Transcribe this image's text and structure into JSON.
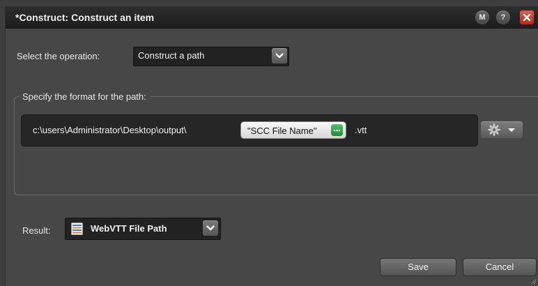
{
  "window": {
    "title": "*Construct: Construct an item",
    "buttons": {
      "m_label": "M",
      "help_label": "?"
    }
  },
  "operation": {
    "label": "Select the operation:",
    "value": "Construct a path"
  },
  "format": {
    "legend": "Specify the format for the path:",
    "path_prefix": "c:\\users\\Administrator\\Desktop\\output\\",
    "token_label": "\"SCC File Name\"",
    "path_suffix": ".vtt"
  },
  "result": {
    "label": "Result:",
    "value": "WebVTT File Path"
  },
  "actions": {
    "save_label": "Save",
    "cancel_label": "Cancel"
  },
  "icons": {
    "menu": "m-icon",
    "help": "help-icon",
    "close": "close-icon",
    "dropdown": "chevron-down-icon",
    "token_menu": "ellipsis-icon",
    "settings": "gear-icon",
    "result_type": "file-path-icon",
    "resize": "resize-grip-icon"
  },
  "colors": {
    "window_bg": "#474747",
    "titlebar_bg": "#1e1e1e",
    "close_red": "#d2301f",
    "token_green": "#2ea447",
    "field_bg": "#262626"
  }
}
